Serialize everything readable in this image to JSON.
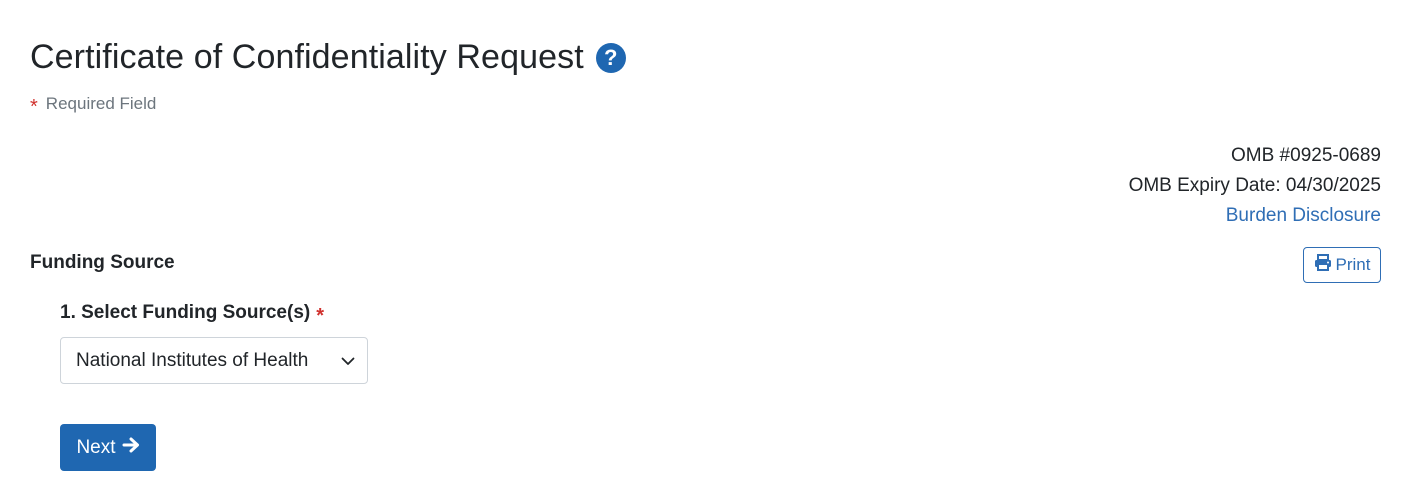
{
  "header": {
    "title": "Certificate of Confidentiality Request",
    "help_icon": "question-circle-icon"
  },
  "required": {
    "marker": "*",
    "label": "Required Field"
  },
  "omb": {
    "number": "OMB #0925-0689",
    "expiry": "OMB Expiry Date: 04/30/2025",
    "burden_link": "Burden Disclosure"
  },
  "section": {
    "title": "Funding Source",
    "print_label": "Print",
    "print_icon": "printer-icon"
  },
  "field": {
    "label": "1. Select Funding Source(s)",
    "required_marker": "*",
    "selected_value": "National Institutes of Health",
    "dropdown_icon": "chevron-down-icon"
  },
  "actions": {
    "next_label": "Next",
    "next_icon": "arrow-right-icon"
  },
  "colors": {
    "primary": "#1f67b1",
    "link": "#2f6eb5",
    "required": "#d0312d",
    "muted": "#6c757d"
  }
}
